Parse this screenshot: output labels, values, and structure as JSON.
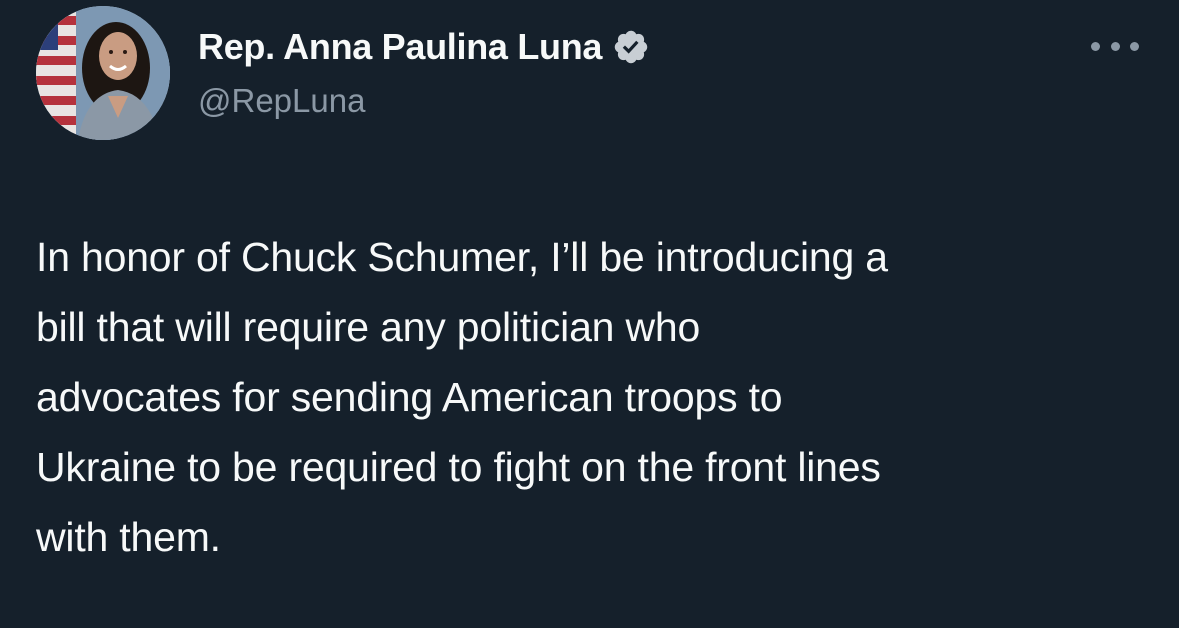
{
  "author": {
    "display_name": "Rep. Anna Paulina Luna",
    "handle": "@RepLuna",
    "verified": true,
    "verified_color": "#8b98a5"
  },
  "tweet": {
    "text_lines": [
      "In honor of Chuck Schumer, I’ll be introducing a",
      "bill that will require any politician who",
      "advocates for sending American troops to",
      "Ukraine to be required to fight on the front lines",
      "with them."
    ]
  },
  "icons": {
    "more": "more-options-icon",
    "verified": "verified-badge-icon",
    "avatar": "profile-photo"
  },
  "colors": {
    "background": "#15202b",
    "text": "#f7f9f9",
    "secondary": "#8b98a5"
  }
}
